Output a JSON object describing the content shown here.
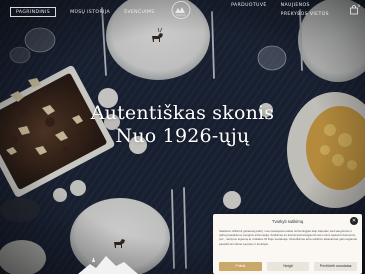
{
  "nav": {
    "left": [
      {
        "label": "Pagrindinis",
        "active": true
      },
      {
        "label": "Mūsų istorija",
        "active": false
      },
      {
        "label": "Švenčiams",
        "active": false
      }
    ],
    "right": [
      {
        "label": "Parduotuvė"
      },
      {
        "label": "Naujienos"
      },
      {
        "label": "Prekybos vietos"
      }
    ],
    "cart_count": "0"
  },
  "hero": {
    "line1": "Autentiškas skonis",
    "line2": "Nuo 1926-ųjų"
  },
  "cookie": {
    "title": "Tvarkyti sutikimą",
    "text": "Siekdami užtikrinti geriausią patirtį, mes naudojame tokias technologijas kaip slapukai, kad saugotume ir (arba) pasiektume įrenginio informaciją. Sutikimas su šiomis technologijomis leis mums apdoroti duomenis, pvz., naršymo elgseną ar unikalius ID šioje svetainėje. Nesutikimas arba sutikimo atšaukimas gali neigiamai paveikti tam tikras savybes ir funkcijas.",
    "accept": "Priimti",
    "deny": "Neigti",
    "prefs": "Peržiūrėti nuostatas"
  },
  "colors": {
    "accent": "#c9a86a",
    "tablecloth": "#1c2332"
  }
}
